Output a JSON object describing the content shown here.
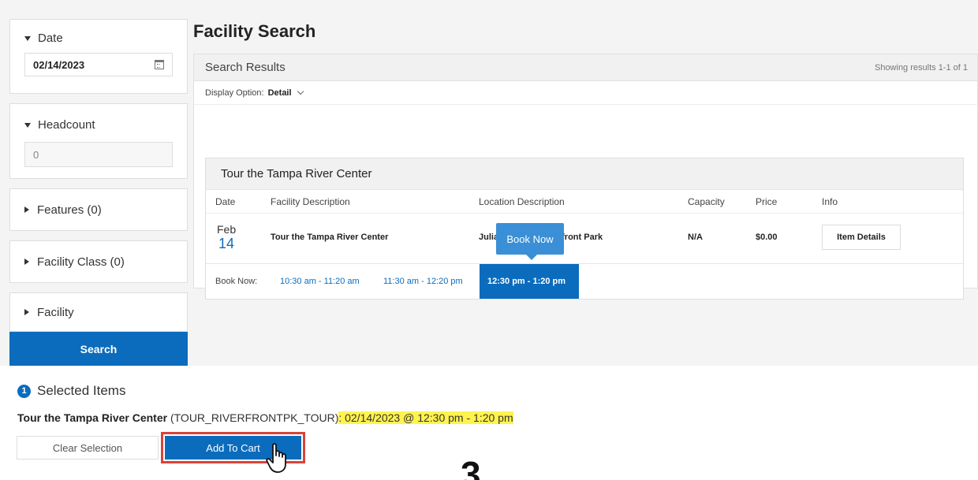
{
  "sidebar": {
    "date": {
      "label": "Date",
      "value": "02/14/2023"
    },
    "headcount": {
      "label": "Headcount",
      "value": "0"
    },
    "features": {
      "label": "Features (0)"
    },
    "facility_class": {
      "label": "Facility Class (0)"
    },
    "facility": {
      "label": "Facility"
    },
    "search_label": "Search"
  },
  "main": {
    "title": "Facility Search",
    "results_title": "Search Results",
    "results_count": "Showing results 1-1 of 1",
    "display_option_label": "Display Option:",
    "display_option_value": "Detail",
    "card": {
      "title": "Tour the Tampa River Center",
      "columns": [
        "Date",
        "Facility Description",
        "Location Description",
        "Capacity",
        "Price",
        "Info"
      ],
      "row": {
        "month": "Feb",
        "day": "14",
        "facility": "Tour the Tampa River Center",
        "location": "Julian B. Lane Riverfront Park",
        "capacity": "N/A",
        "price": "$0.00",
        "info_button": "Item Details"
      },
      "tooltip": "Book Now",
      "book_now_label": "Book Now:",
      "slots": [
        "10:30 am - 11:20 am",
        "11:30 am - 12:20 pm",
        "12:30 pm - 1:20 pm"
      ]
    }
  },
  "selected": {
    "count": "1",
    "title": "Selected Items",
    "item_name": "Tour the Tampa River Center",
    "item_code": "(TOUR_RIVERFRONTPK_TOUR)",
    "separator": ":",
    "item_when": "02/14/2023 @ 12:30 pm - 1:20 pm",
    "clear_label": "Clear Selection",
    "add_label": "Add To Cart"
  },
  "step_number": "3",
  "colors": {
    "accent": "#0b6cbd",
    "highlight": "#fff34d",
    "outline": "#d9433a"
  }
}
